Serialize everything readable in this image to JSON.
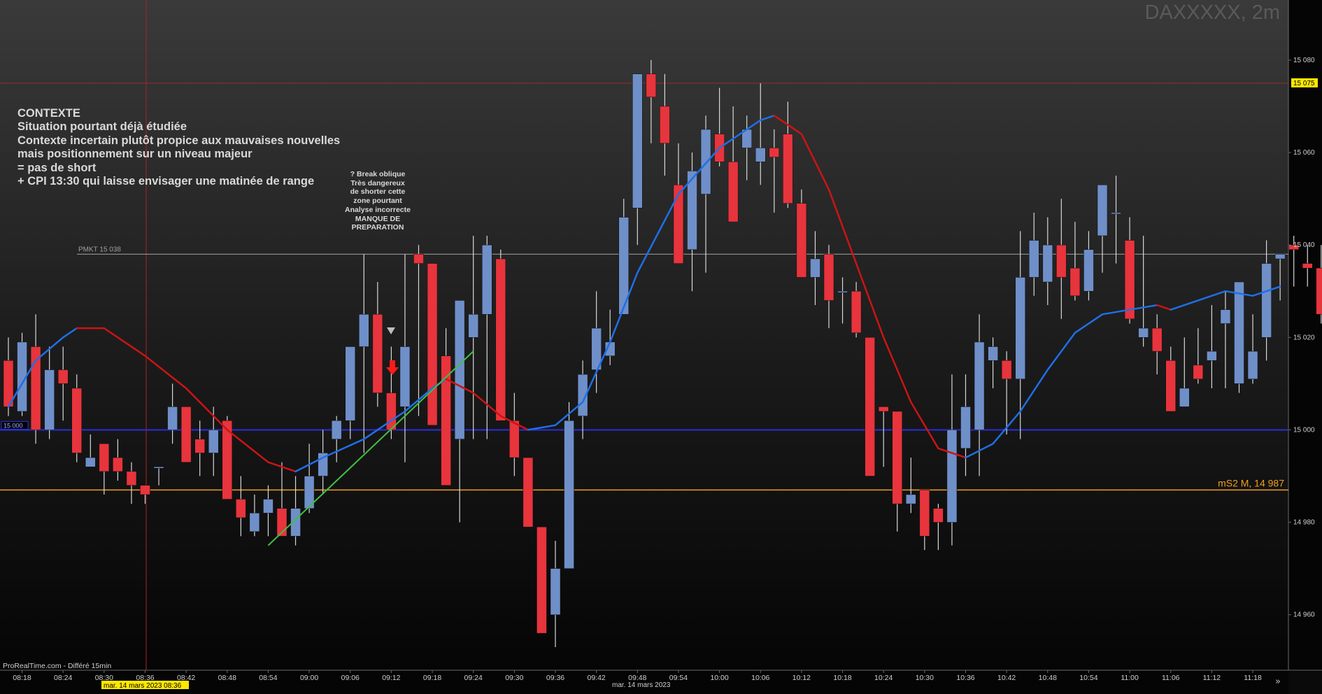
{
  "header": {
    "title": "DAXXXXX, 2m"
  },
  "footer": {
    "source": "ProRealTime.com - Différé 15min",
    "date_center": "mar. 14 mars 2023",
    "cursor_date": "mar. 14 mars 2023 08:36"
  },
  "annotations": {
    "context_lines": [
      "CONTEXTE",
      "Situation pourtant déjà étudiée",
      "Contexte incertain plutôt propice aux mauvaises nouvelles",
      "mais positionnement sur un niveau majeur",
      "= pas de short",
      "+ CPI 13:30 qui laisse envisager une matinée de range"
    ],
    "break_lines": [
      "? Break oblique",
      "Très dangereux",
      "de shorter cette",
      "zone pourtant",
      "Analyse incorrecte",
      "MANQUE DE",
      "PREPARATION"
    ]
  },
  "colors": {
    "background": "#000000",
    "bull_candle": "#6f8fc9",
    "bear_candle": "#e8343c",
    "wick": "#d8d8d8",
    "level_blue": "#2a2ee0",
    "level_orange": "#f0a020",
    "level_red": "#9a2a2a",
    "pmkt_gray": "#8a8a8a",
    "ma_up": "#1f6fe6",
    "ma_down": "#cc1414",
    "trendline": "#40c040",
    "axis_text": "#cfcfcf",
    "price_tag_bg": "#ffe800"
  },
  "icons": [
    "down-arrow-red-icon",
    "down-arrow-gray-icon",
    "scroll-right-icon"
  ],
  "chart_data": {
    "type": "candlestick",
    "timeframe": "2m",
    "y_ticks": [
      15080,
      15060,
      15040,
      15020,
      15000,
      14980,
      14960
    ],
    "ylim": [
      14948,
      15093
    ],
    "x_ticks": [
      "08:18",
      "08:24",
      "08:30",
      "08:36",
      "08:42",
      "08:48",
      "08:54",
      "09:00",
      "09:06",
      "09:12",
      "09:18",
      "09:24",
      "09:30",
      "09:36",
      "09:42",
      "09:48",
      "09:54",
      "10:00",
      "10:06",
      "10:12",
      "10:18",
      "10:24",
      "10:30",
      "10:36",
      "10:42",
      "10:48",
      "10:54",
      "11:00",
      "11:06",
      "11:12",
      "11:18"
    ],
    "x_first_tick_index": 1,
    "levels": [
      {
        "name": "15 075",
        "value": 15075,
        "tag": "15 075"
      },
      {
        "name": "PMKT 15 038",
        "value": 15038,
        "label": "PMKT 15 038"
      },
      {
        "name": "15 000",
        "value": 15000,
        "tag": "15 000"
      },
      {
        "name": "mS2 M, 14 987",
        "value": 14987,
        "label": "mS2 M, 14 987"
      }
    ],
    "candles": [
      [
        15015,
        15020,
        15003,
        15005
      ],
      [
        15004,
        15021,
        15003,
        15019
      ],
      [
        15018,
        15025,
        14997,
        15000
      ],
      [
        15000,
        15018,
        14998,
        15013
      ],
      [
        15013,
        15018,
        15002,
        15010
      ],
      [
        15009,
        15012,
        14993,
        14995
      ],
      [
        14992,
        14999,
        14996,
        14994
      ],
      [
        14997,
        14990,
        14986,
        14991
      ],
      [
        14994,
        14998,
        14989,
        14991
      ],
      [
        14991,
        14993,
        14984,
        14988
      ],
      [
        14988,
        14986,
        14984,
        14986
      ],
      [
        14992,
        14990,
        14988,
        14992
      ],
      [
        15000,
        15010,
        14997,
        15005
      ],
      [
        15005,
        15000,
        14996,
        14993
      ],
      [
        14998,
        15002,
        14990,
        14995
      ],
      [
        14995,
        15005,
        14990,
        15000
      ],
      [
        15002,
        15003,
        14993,
        14985
      ],
      [
        14985,
        14990,
        14977,
        14981
      ],
      [
        14978,
        14986,
        14977,
        14982
      ],
      [
        14982,
        14988,
        14977,
        14985
      ],
      [
        14983,
        14993,
        14977,
        14977
      ],
      [
        14977,
        14990,
        14975,
        14983
      ],
      [
        14983,
        14997,
        14982,
        14990
      ],
      [
        14990,
        15000,
        14986,
        14995
      ],
      [
        14998,
        15003,
        14993,
        15002
      ],
      [
        15002,
        15015,
        14998,
        15018
      ],
      [
        15018,
        15038,
        14995,
        15025
      ],
      [
        15025,
        15032,
        15005,
        15008
      ],
      [
        15008,
        15018,
        14998,
        15000
      ],
      [
        15005,
        15038,
        14993,
        15018
      ],
      [
        15038,
        15040,
        15003,
        15036
      ],
      [
        15036,
        15030,
        15013,
        15001
      ],
      [
        15016,
        15022,
        14994,
        14988
      ],
      [
        14998,
        15025,
        14980,
        15028
      ],
      [
        15020,
        15042,
        14998,
        15025
      ],
      [
        15025,
        15042,
        14998,
        15040
      ],
      [
        15037,
        15039,
        15011,
        15002
      ],
      [
        15002,
        15008,
        14990,
        14994
      ],
      [
        14994,
        14990,
        14980,
        14979
      ],
      [
        14979,
        14978,
        14956,
        14956
      ],
      [
        14960,
        14976,
        14953,
        14970
      ],
      [
        14970,
        15006,
        14970,
        15002
      ],
      [
        15003,
        15015,
        14998,
        15012
      ],
      [
        15013,
        15030,
        15008,
        15022
      ],
      [
        15016,
        15026,
        15014,
        15019
      ],
      [
        15025,
        15050,
        15025,
        15046
      ],
      [
        15048,
        15075,
        15040,
        15077
      ],
      [
        15077,
        15080,
        15062,
        15072
      ],
      [
        15070,
        15077,
        15055,
        15062
      ],
      [
        15053,
        15062,
        15040,
        15036
      ],
      [
        15039,
        15060,
        15030,
        15056
      ],
      [
        15051,
        15068,
        15034,
        15065
      ],
      [
        15064,
        15074,
        15057,
        15058
      ],
      [
        15058,
        15070,
        15048,
        15045
      ],
      [
        15061,
        15068,
        15054,
        15065
      ],
      [
        15058,
        15075,
        15053,
        15061
      ],
      [
        15061,
        15065,
        15047,
        15059
      ],
      [
        15064,
        15071,
        15048,
        15049
      ],
      [
        15049,
        15052,
        15037,
        15033
      ],
      [
        15033,
        15043,
        15027,
        15037
      ],
      [
        15038,
        15040,
        15022,
        15028
      ],
      [
        15030,
        15033,
        15023,
        15030
      ],
      [
        15030,
        15032,
        15020,
        15021
      ],
      [
        15020,
        15020,
        14990,
        14990
      ],
      [
        15005,
        15001,
        14992,
        15004
      ],
      [
        15004,
        15002,
        14978,
        14984
      ],
      [
        14984,
        14994,
        14982,
        14986
      ],
      [
        14987,
        14987,
        14974,
        14977
      ],
      [
        14983,
        14984,
        14974,
        14980
      ],
      [
        14980,
        15012,
        14975,
        15000
      ],
      [
        14996,
        15012,
        14990,
        15005
      ],
      [
        15000,
        15025,
        14990,
        15019
      ],
      [
        15015,
        15020,
        15009,
        15018
      ],
      [
        15015,
        15017,
        14999,
        15011
      ],
      [
        15011,
        15043,
        14998,
        15033
      ],
      [
        15033,
        15047,
        15029,
        15041
      ],
      [
        15032,
        15046,
        15027,
        15040
      ],
      [
        15040,
        15050,
        15024,
        15033
      ],
      [
        15035,
        15045,
        15028,
        15029
      ],
      [
        15030,
        15043,
        15028,
        15039
      ],
      [
        15042,
        15052,
        15034,
        15053
      ],
      [
        15047,
        15055,
        15036,
        15047
      ],
      [
        15041,
        15046,
        15023,
        15024
      ],
      [
        15020,
        15042,
        15018,
        15022
      ],
      [
        15022,
        15025,
        15012,
        15017
      ],
      [
        15015,
        15018,
        15005,
        15004
      ],
      [
        15005,
        15020,
        15005,
        15009
      ],
      [
        15014,
        15022,
        15010,
        15011
      ],
      [
        15015,
        15027,
        15009,
        15017
      ],
      [
        15023,
        15030,
        15009,
        15026
      ],
      [
        15010,
        15031,
        15008,
        15032
      ],
      [
        15011,
        15025,
        15010,
        15017
      ],
      [
        15020,
        15041,
        15015,
        15036
      ],
      [
        15037,
        15038,
        15028,
        15038
      ],
      [
        15040,
        15042,
        15031,
        15039
      ],
      [
        15036,
        15040,
        15031,
        15035
      ],
      [
        15035,
        15040,
        15023,
        15025
      ],
      [
        15024,
        15037,
        15018,
        15019
      ],
      [
        15019,
        15018,
        15013,
        15013
      ],
      [
        15015,
        15037,
        15014,
        15034
      ],
      [
        15036,
        15046,
        15031,
        15042
      ]
    ],
    "ma_segments": [
      {
        "color": "ma_up",
        "points": [
          [
            0,
            15005
          ],
          [
            2,
            15015
          ],
          [
            4,
            15020
          ],
          [
            5,
            15022
          ]
        ]
      },
      {
        "color": "ma_down",
        "points": [
          [
            5,
            15022
          ],
          [
            7,
            15022
          ],
          [
            10,
            15016
          ],
          [
            13,
            15009
          ],
          [
            16,
            15000
          ],
          [
            19,
            14993
          ],
          [
            21,
            14991
          ]
        ]
      },
      {
        "color": "ma_up",
        "points": [
          [
            21,
            14991
          ],
          [
            23,
            14994
          ],
          [
            26,
            14998
          ],
          [
            29,
            15004
          ],
          [
            31,
            15009
          ],
          [
            32,
            15011
          ]
        ]
      },
      {
        "color": "ma_down",
        "points": [
          [
            32,
            15011
          ],
          [
            34,
            15008
          ],
          [
            36,
            15003
          ],
          [
            38,
            15000
          ]
        ]
      },
      {
        "color": "ma_up",
        "points": [
          [
            38,
            15000
          ],
          [
            40,
            15001
          ],
          [
            42,
            15006
          ],
          [
            44,
            15019
          ],
          [
            46,
            15034
          ],
          [
            49,
            15051
          ],
          [
            52,
            15061
          ],
          [
            55,
            15067
          ],
          [
            56,
            15068
          ]
        ]
      },
      {
        "color": "ma_down",
        "points": [
          [
            56,
            15068
          ],
          [
            58,
            15064
          ],
          [
            60,
            15052
          ],
          [
            62,
            15036
          ],
          [
            64,
            15020
          ],
          [
            66,
            15006
          ],
          [
            68,
            14996
          ],
          [
            70,
            14994
          ]
        ]
      },
      {
        "color": "ma_up",
        "points": [
          [
            70,
            14994
          ],
          [
            72,
            14997
          ],
          [
            74,
            15004
          ],
          [
            76,
            15013
          ],
          [
            78,
            15021
          ],
          [
            80,
            15025
          ],
          [
            82,
            15026
          ],
          [
            84,
            15027
          ]
        ]
      },
      {
        "color": "ma_down",
        "points": [
          [
            84,
            15027
          ],
          [
            85,
            15026
          ]
        ]
      },
      {
        "color": "ma_up",
        "points": [
          [
            85,
            15026
          ],
          [
            87,
            15028
          ],
          [
            89,
            15030
          ],
          [
            91,
            15029
          ],
          [
            93,
            15031
          ]
        ]
      }
    ],
    "trendline": {
      "from": [
        19,
        14975
      ],
      "to": [
        34,
        15017
      ]
    }
  }
}
